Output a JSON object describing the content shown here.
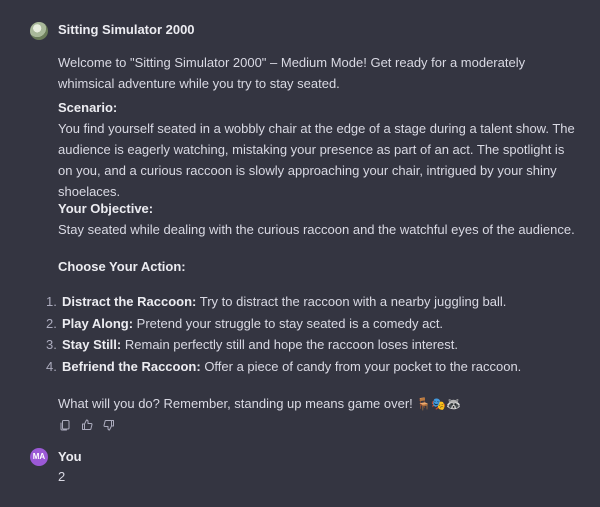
{
  "assistant": {
    "name": "Sitting Simulator 2000",
    "avatar_icon": "assistant-avatar-icon",
    "intro": "Welcome to \"Sitting Simulator 2000\" – Medium Mode! Get ready for a moderately whimsical adventure while you try to stay seated.",
    "scenario_heading": "Scenario:",
    "scenario_text": "You find yourself seated in a wobbly chair at the edge of a stage during a talent show. The audience is eagerly watching, mistaking your presence as part of an act. The spotlight is on you, and a curious raccoon is slowly approaching your chair, intrigued by your shiny shoelaces.",
    "objective_heading": "Your Objective:",
    "objective_text": "Stay seated while dealing with the curious raccoon and the watchful eyes of the audience.",
    "action_heading": "Choose Your Action:",
    "actions": [
      {
        "num": "1.",
        "name": "Distract the Raccoon:",
        "text": "Try to distract the raccoon with a nearby juggling ball."
      },
      {
        "num": "2.",
        "name": "Play Along:",
        "text": "Pretend your struggle to stay seated is a comedy act."
      },
      {
        "num": "3.",
        "name": "Stay Still:",
        "text": "Remain perfectly still and hope the raccoon loses interest."
      },
      {
        "num": "4.",
        "name": "Befriend the Raccoon:",
        "text": "Offer a piece of candy from your pocket to the raccoon."
      }
    ],
    "closing_text": "What will you do? Remember, standing up means game over!",
    "closing_emojis": "🪑🎭🦝"
  },
  "feedback": {
    "icons": [
      "copy-icon",
      "thumbs-up-icon",
      "thumbs-down-icon"
    ]
  },
  "user": {
    "initials": "MA",
    "name": "You",
    "message": "2"
  },
  "colors": {
    "background": "#343541",
    "text": "#d9d9e3",
    "user_avatar": "#9b59d6"
  }
}
